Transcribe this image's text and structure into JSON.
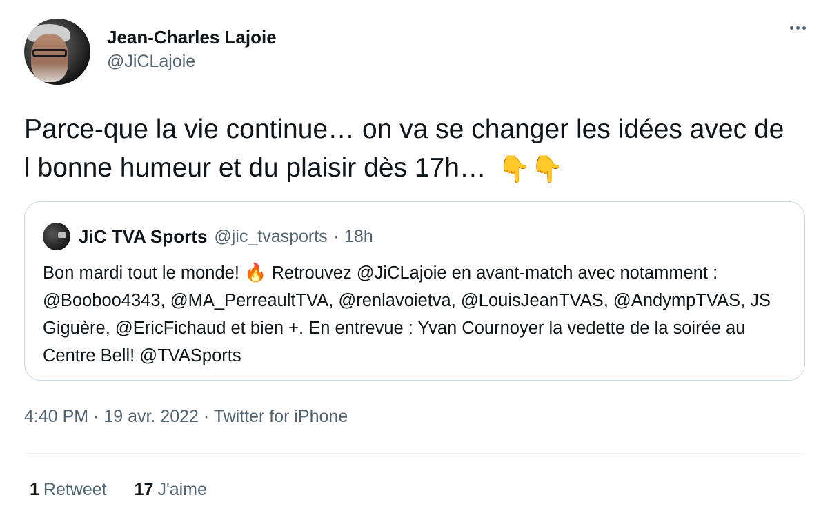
{
  "author": {
    "display_name": "Jean-Charles Lajoie",
    "handle": "@JiCLajoie"
  },
  "tweet": {
    "text": "Parce-que la vie continue… on va se changer les idées avec de l bonne humeur et du plaisir dès 17h…",
    "emoji": "👇👇"
  },
  "quoted": {
    "display_name": "JiC TVA Sports",
    "handle": "@jic_tvasports",
    "separator": "·",
    "time": "18h",
    "text_before_emoji": "Bon mardi tout le monde!",
    "emoji": "🔥",
    "text_after_emoji": "Retrouvez @JiCLajoie en avant-match avec notamment : @Booboo4343, @MA_PerreaultTVA, @renlavoietva, @LouisJeanTVAS, @AndympTVAS, JS Giguère, @EricFichaud et bien +. En entrevue : Yvan Cournoyer la vedette de la soirée au Centre Bell! @TVASports"
  },
  "meta": "4:40 PM · 19 avr. 2022 · Twitter for iPhone",
  "stats": {
    "retweets_count": "1",
    "retweets_label": "Retweet",
    "likes_count": "17",
    "likes_label": "J'aime"
  },
  "icons": {
    "more": "more-horizontal-icon"
  },
  "colors": {
    "primary_text": "#0f1419",
    "secondary_text": "#536471",
    "border": "#cfd9de"
  }
}
